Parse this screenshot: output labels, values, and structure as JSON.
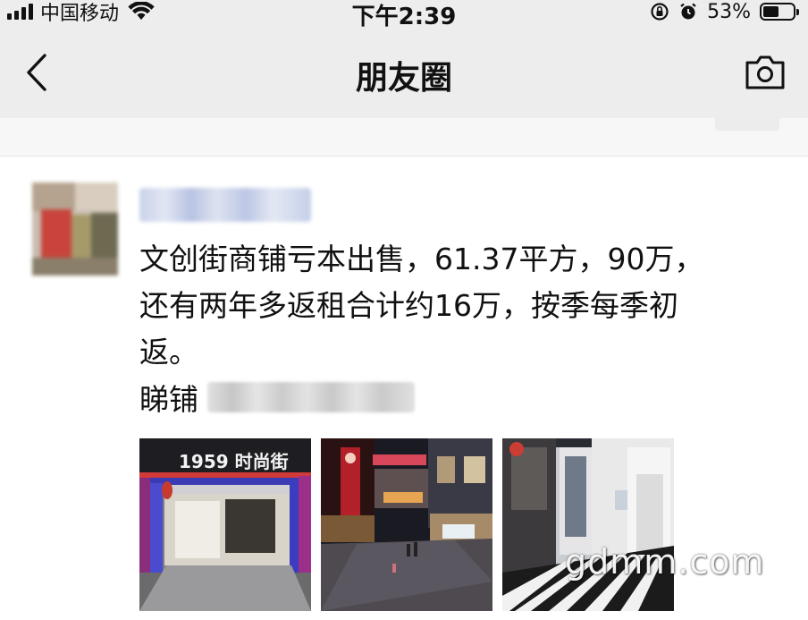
{
  "status_bar": {
    "carrier": "中国移动",
    "time": "下午2:39",
    "battery": "53%",
    "battery_level": 0.53,
    "icons": [
      "signal-icon",
      "wifi-icon",
      "rotation-lock-icon",
      "alarm-icon",
      "battery-icon"
    ]
  },
  "nav": {
    "title": "朋友圈",
    "back_icon": "chevron-left-icon",
    "camera_icon": "camera-icon"
  },
  "post": {
    "lines": [
      "文创街商铺亏本出售，61.37平方，90万，",
      "还有两年多返租合计约16万，按季每季初",
      "返。"
    ],
    "contact_label": "睇铺",
    "photos": [
      {
        "id": "photo-1",
        "sign_text": "1959 时尚街"
      },
      {
        "id": "photo-2"
      },
      {
        "id": "photo-3"
      }
    ]
  },
  "watermark": "gdmm.com",
  "colors": {
    "nav_bg": "#ededed",
    "page_bg": "#ffffff",
    "text": "#111111",
    "nickname_blue": "#c9d2ea"
  }
}
